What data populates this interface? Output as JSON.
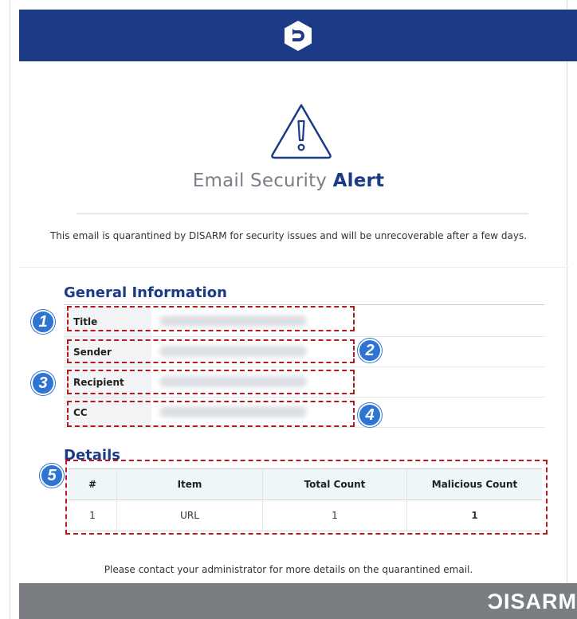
{
  "colors": {
    "header": "#1b3b87",
    "accent": "#1b3b87",
    "highlight": "#b3191e",
    "badge": "#2e75d3",
    "footer": "#7a7d82"
  },
  "header": {
    "logo_icon": "disarm-logo-icon"
  },
  "alert": {
    "icon": "warning-icon",
    "title_plain": "Email Security ",
    "title_accent": "Alert",
    "notice": "This email is quarantined by DISARM for security issues and will be unrecoverable after a few days."
  },
  "general_info": {
    "heading": "General Information",
    "rows": [
      {
        "label": "Title"
      },
      {
        "label": "Sender"
      },
      {
        "label": "Recipient"
      },
      {
        "label": "CC"
      }
    ]
  },
  "details": {
    "heading": "Details",
    "columns": [
      "#",
      "Item",
      "Total Count",
      "Malicious Count"
    ],
    "rows": [
      {
        "no": "1",
        "item": "URL",
        "total": "1",
        "malicious": "1"
      }
    ]
  },
  "badges": [
    "1",
    "2",
    "3",
    "4",
    "5"
  ],
  "contact": "Please contact your administrator for more details on the quarantined email.",
  "footer": {
    "brand": "ƆISARM"
  }
}
